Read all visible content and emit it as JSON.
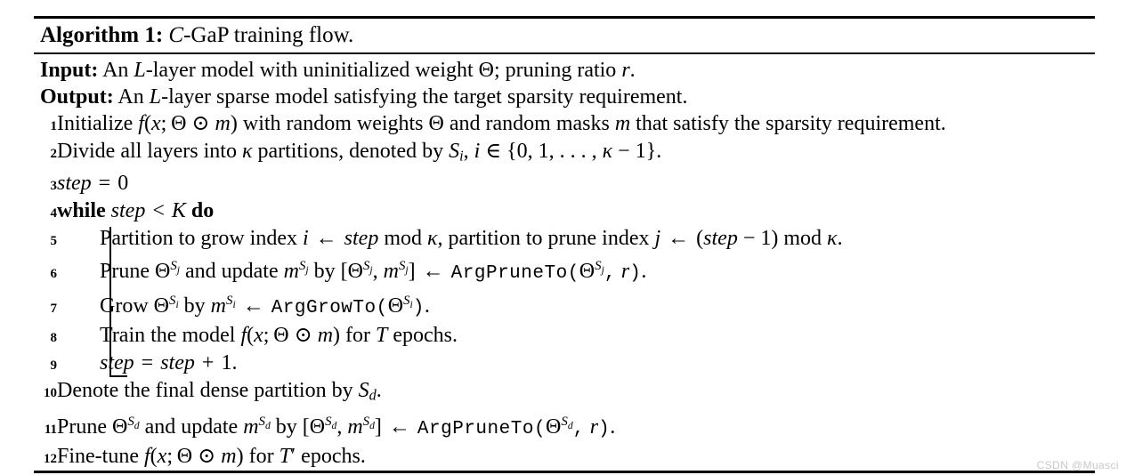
{
  "document": {
    "type": "algorithm-pseudocode",
    "title_prefix": "Algorithm 1:",
    "title_body": "C-GaP training flow.",
    "title_full": "Algorithm 1: C-GaP training flow."
  },
  "io": {
    "input_label": "Input:",
    "input_text": "An L-layer model with uninitialized weight Θ; pruning ratio r.",
    "output_label": "Output:",
    "output_text": "An L-layer sparse model satisfying the target sparsity requirement."
  },
  "lines": [
    {
      "number": "1",
      "indent": 0,
      "text": "Initialize f(x; Θ ⊙ m) with random weights Θ and random masks m that satisfy the sparsity requirement."
    },
    {
      "number": "2",
      "indent": 0,
      "text": "Divide all layers into κ partitions, denoted by Sᵢ, i ∈ {0, 1, . . . , κ − 1}."
    },
    {
      "number": "3",
      "indent": 0,
      "text": "step = 0"
    },
    {
      "number": "4",
      "indent": 0,
      "text": "while step < K do"
    },
    {
      "number": "5",
      "indent": 1,
      "text": "Partition to grow index i ← step mod κ, partition to prune index j ← (step − 1) mod κ."
    },
    {
      "number": "6",
      "indent": 1,
      "text": "Prune Θ^Sj and update m^Sj by [Θ^Sj, m^Sj] ← ArgPruneTo(Θ^Sj, r)."
    },
    {
      "number": "7",
      "indent": 1,
      "text": "Grow Θ^Si by m^Si ← ArgGrowTo(Θ^Si)."
    },
    {
      "number": "8",
      "indent": 1,
      "text": "Train the model f(x; Θ ⊙ m) for T epochs."
    },
    {
      "number": "9",
      "indent": 1,
      "text": "step = step + 1."
    },
    {
      "number": "10",
      "indent": 0,
      "text": "Denote the final dense partition by S_d."
    },
    {
      "number": "11",
      "indent": 0,
      "text": "Prune Θ^Sd and update m^Sd by [Θ^Sd, m^Sd] ← ArgPruneTo(Θ^Sd, r)."
    },
    {
      "number": "12",
      "indent": 0,
      "text": "Fine-tune f(x; Θ ⊙ m) for T′ epochs."
    }
  ],
  "keywords": {
    "while": "while",
    "do": "do",
    "mod": "mod",
    "arg_prune_to": "ArgPruneTo",
    "arg_grow_to": "ArgGrowTo"
  },
  "symbols": {
    "theta": "Θ",
    "kappa": "κ",
    "odot": "⊙",
    "leftarrow": "←",
    "in": "∈",
    "minus": "−",
    "lt": "<",
    "eq": "=",
    "plus": "+"
  },
  "watermark": {
    "text": "CSDN @Muasci",
    "color": "#c9c9c9"
  }
}
